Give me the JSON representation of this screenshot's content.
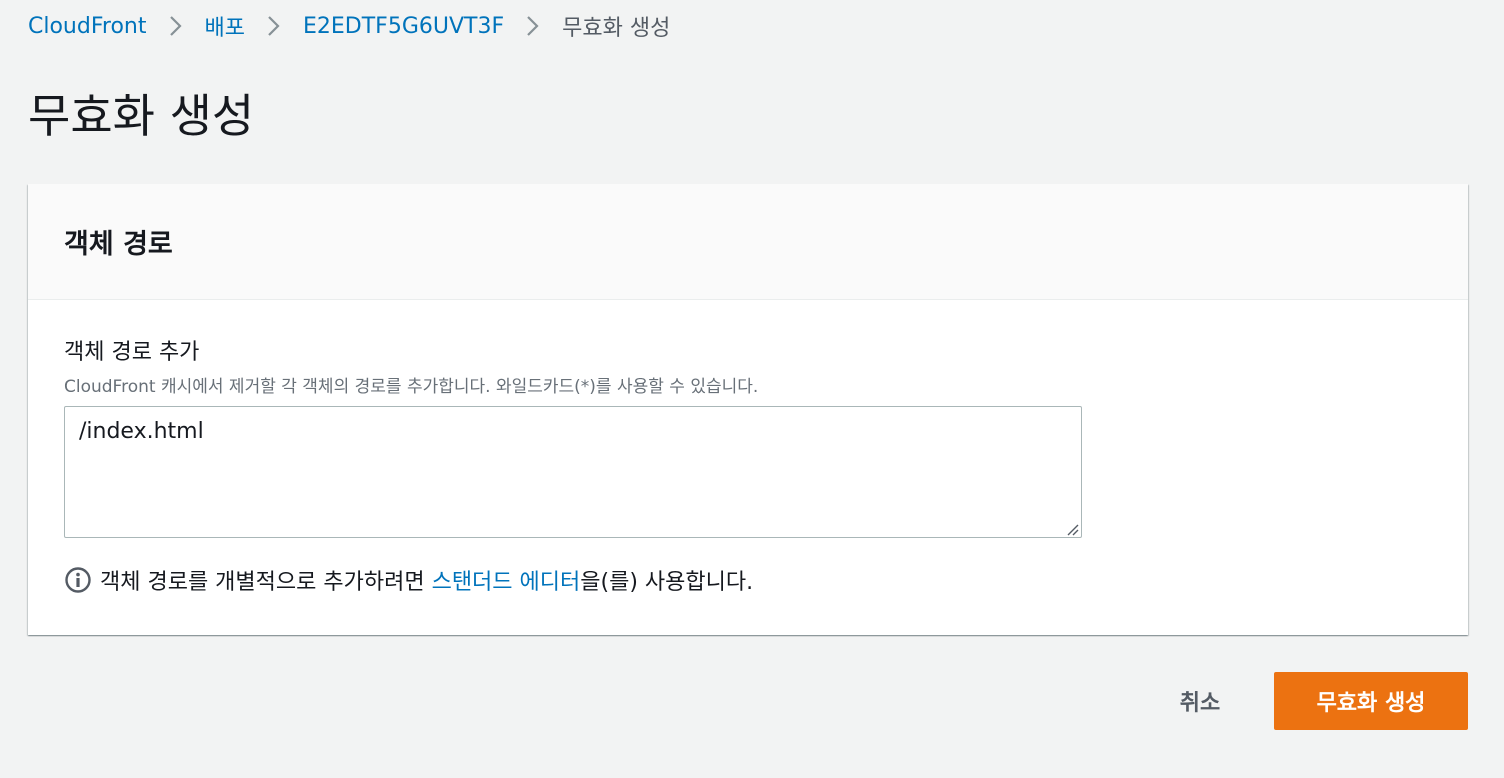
{
  "breadcrumb": {
    "items": [
      {
        "label": "CloudFront"
      },
      {
        "label": "배포"
      },
      {
        "label": "E2EDTF5G6UVT3F"
      }
    ],
    "current": "무효화 생성"
  },
  "page": {
    "title": "무효화 생성"
  },
  "panel": {
    "title": "객체 경로",
    "field_label": "객체 경로 추가",
    "field_description": "CloudFront 캐시에서 제거할 각 객체의 경로를 추가합니다. 와일드카드(*)를 사용할 수 있습니다.",
    "field_value": "/index.html",
    "info_prefix": "객체 경로를 개별적으로 추가하려면 ",
    "info_link": "스탠더드 에디터",
    "info_suffix": "을(를) 사용합니다."
  },
  "actions": {
    "cancel_label": "취소",
    "submit_label": "무효화 생성"
  },
  "icons": {
    "separator": "chevron-right-icon",
    "info": "info-icon",
    "resize": "resize-grip-icon"
  },
  "colors": {
    "link": "#0073bb",
    "primary": "#ec7211",
    "background": "#f2f3f3",
    "muted_text": "#687078"
  }
}
